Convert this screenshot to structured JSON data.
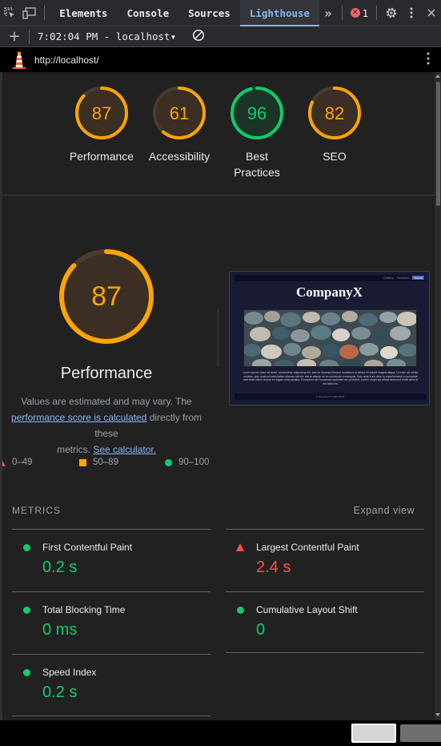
{
  "devtools": {
    "tabs": [
      "Elements",
      "Console",
      "Sources",
      "Lighthouse"
    ],
    "active_tab": "Lighthouse",
    "more_tabs": "»",
    "error_count": "1"
  },
  "toolbar": {
    "add": "+",
    "run_label": "7:02:04 PM - localhost",
    "run_caret": "▾"
  },
  "url": "http://localhost/",
  "colors": {
    "pass": "#0cce6b",
    "average": "#ffa400",
    "fail": "#ff4e42",
    "link": "#8ab4f8"
  },
  "scores": [
    {
      "label": "Performance",
      "value": "87",
      "status": "average"
    },
    {
      "label": "Accessibility",
      "value": "61",
      "status": "average"
    },
    {
      "label": "Best Practices",
      "value": "96",
      "status": "pass"
    },
    {
      "label": "SEO",
      "value": "82",
      "status": "average"
    }
  ],
  "performance": {
    "score": "87",
    "label": "Performance",
    "desc_line1": "Values are estimated and may vary. The",
    "desc_link1": "performance score is calculated",
    "desc_mid": " directly from these",
    "desc_line3": "metrics. ",
    "desc_link2": "See calculator."
  },
  "legend": [
    {
      "range": "0–49",
      "shape": "triangle"
    },
    {
      "range": "50–89",
      "shape": "square"
    },
    {
      "range": "90–100",
      "shape": "circle"
    }
  ],
  "thumbnail": {
    "title": "CompanyX",
    "nav": [
      "Gallery",
      "Services",
      "Home"
    ],
    "body": "Lorem ipsum dolor sit amet, consectetur adipiscing elit, sed do eiusmod tempor incididunt ut labore et dolore magna aliqua. Ut enim ad minim veniam, quis nostrud exercitation ullamco laboris nisi ut aliquip ex ea commodo consequat. Duis aute irure dolor in reprehenderit in voluptate velit esse cillum dolore eu fugiat nulla pariatur. Excepteur sint occaecat cupidatat non proident, sunt in culpa qui officia deserunt mollit anim id est laborum.",
    "footer": "© CompanyX ImplEd 2024"
  },
  "metrics_section": {
    "title": "METRICS",
    "expand": "Expand view"
  },
  "metrics": [
    {
      "name": "First Contentful Paint",
      "value": "0.2 s",
      "status": "pass"
    },
    {
      "name": "Largest Contentful Paint",
      "value": "2.4 s",
      "status": "fail"
    },
    {
      "name": "Total Blocking Time",
      "value": "0 ms",
      "status": "pass"
    },
    {
      "name": "Cumulative Layout Shift",
      "value": "0",
      "status": "pass"
    },
    {
      "name": "Speed Index",
      "value": "0.2 s",
      "status": "pass"
    }
  ]
}
